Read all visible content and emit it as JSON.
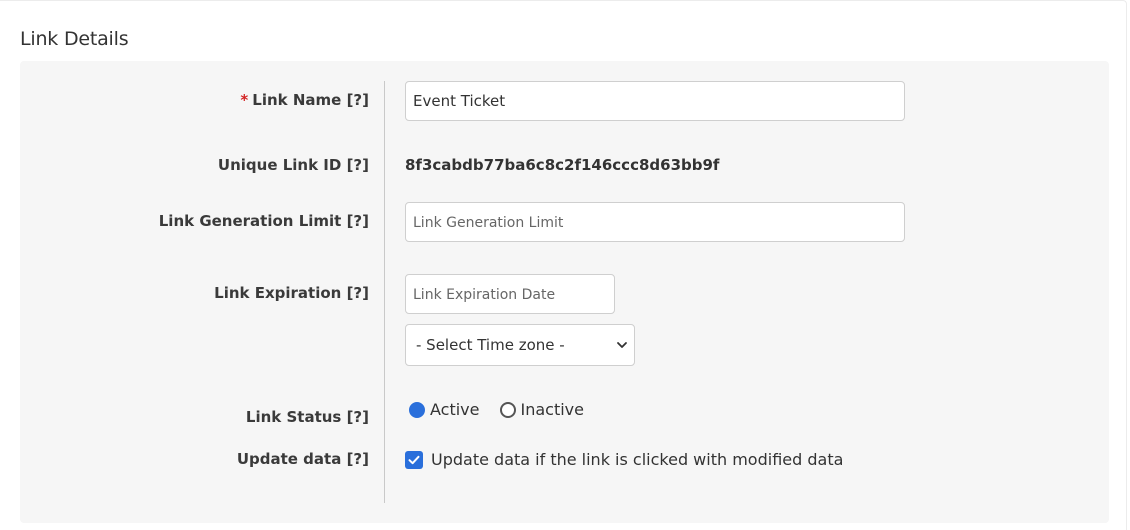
{
  "section_title": "Link Details",
  "fields": {
    "link_name": {
      "required_mark": "*",
      "label": "Link Name",
      "help": "[?]",
      "value": "Event Ticket"
    },
    "unique_link_id": {
      "label": "Unique Link ID",
      "help": "[?]",
      "value": "8f3cabdb77ba6c8c2f146ccc8d63bb9f"
    },
    "link_generation_limit": {
      "label": "Link Generation Limit",
      "help": "[?]",
      "placeholder": "Link Generation Limit",
      "value": ""
    },
    "link_expiration": {
      "label": "Link Expiration",
      "help": "[?]",
      "date_placeholder": "Link Expiration Date",
      "timezone_selected": "- Select Time zone -"
    },
    "link_status": {
      "label": "Link Status",
      "help": "[?]",
      "options": [
        {
          "label": "Active",
          "selected": true
        },
        {
          "label": "Inactive",
          "selected": false
        }
      ]
    },
    "update_data": {
      "label": "Update data",
      "help": "[?]",
      "checkbox_label": "Update data if the link is clicked with modified data",
      "checked": true
    }
  },
  "icons": {
    "select_chevron": "chevron-down-icon",
    "checkbox_check": "checkmark-icon"
  },
  "colors": {
    "accent": "#2a6fdb",
    "required": "#d32424",
    "panel_bg": "#f6f6f6"
  }
}
